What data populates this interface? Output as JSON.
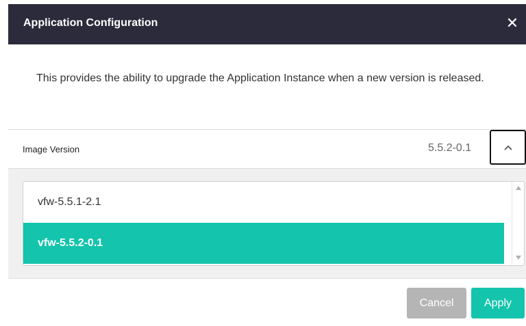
{
  "dialog": {
    "title": "Application Configuration",
    "close_glyph": "✕",
    "description": "This provides the ability to upgrade the Application Instance when a new version is released."
  },
  "image_version": {
    "label": "Image Version",
    "selected_value": "5.5.2-0.1",
    "toggle_icon": "chevron-up-icon"
  },
  "version_list": {
    "options": [
      {
        "label": "vfw-5.5.1-2.1",
        "selected": false
      },
      {
        "label": "vfw-5.5.2-0.1",
        "selected": true
      }
    ]
  },
  "footer": {
    "cancel_label": "Cancel",
    "apply_label": "Apply"
  },
  "colors": {
    "header_bg": "#2b2b3b",
    "accent": "#14c4ac",
    "disabled_button": "#b5b5b5"
  }
}
